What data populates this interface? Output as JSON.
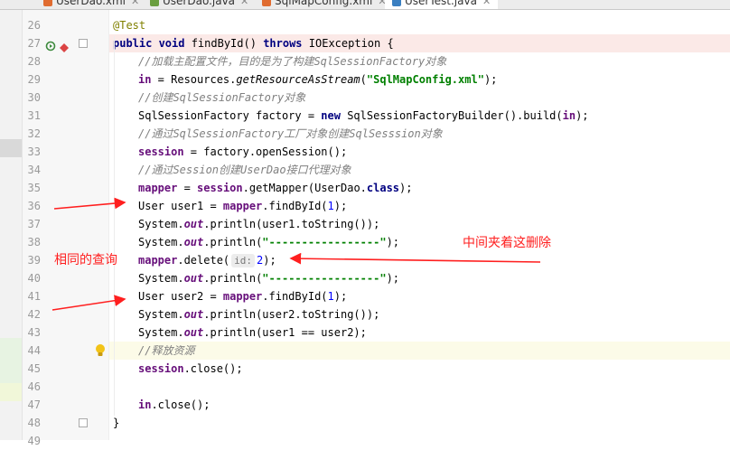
{
  "tabs": [
    {
      "label": "UserDao.xml",
      "icon_color": "#e06c30",
      "active": false
    },
    {
      "label": "UserDao.java",
      "icon_color": "#6a9e3f",
      "active": false
    },
    {
      "label": "SqlMapConfig.xml",
      "icon_color": "#e06c30",
      "active": false
    },
    {
      "label": "UserTest.java",
      "icon_color": "#3a7fc1",
      "active": true
    }
  ],
  "lines": [
    {
      "n": "26",
      "indent": 1,
      "tokens": [
        {
          "c": "ann",
          "t": "@Test"
        }
      ]
    },
    {
      "n": "27",
      "indent": 1,
      "hl": "method",
      "run_icon": true,
      "breakpoint": true,
      "tokens": [
        {
          "c": "kw",
          "t": "public void "
        },
        {
          "c": "",
          "t": "findById() "
        },
        {
          "c": "kw",
          "t": "throws "
        },
        {
          "c": "",
          "t": "IOException {"
        }
      ]
    },
    {
      "n": "28",
      "indent": 2,
      "tokens": [
        {
          "c": "cm",
          "t": "//加载主配置文件，目的是为了构建SqlSessionFactory对象"
        }
      ]
    },
    {
      "n": "29",
      "indent": 2,
      "tokens": [
        {
          "c": "fld",
          "t": "in"
        },
        {
          "c": "",
          "t": " = Resources."
        },
        {
          "c": "smeth",
          "t": "getResourceAsStream"
        },
        {
          "c": "",
          "t": "("
        },
        {
          "c": "str",
          "t": "\"SqlMapConfig.xml\""
        },
        {
          "c": "",
          "t": ");"
        }
      ]
    },
    {
      "n": "30",
      "indent": 2,
      "tokens": [
        {
          "c": "cm",
          "t": "//创建SqlSessionFactory对象"
        }
      ]
    },
    {
      "n": "31",
      "indent": 2,
      "tokens": [
        {
          "c": "",
          "t": "SqlSessionFactory factory = "
        },
        {
          "c": "kw",
          "t": "new "
        },
        {
          "c": "",
          "t": "SqlSessionFactoryBuilder().build("
        },
        {
          "c": "fld",
          "t": "in"
        },
        {
          "c": "",
          "t": ");"
        }
      ]
    },
    {
      "n": "32",
      "indent": 2,
      "tokens": [
        {
          "c": "cm",
          "t": "//通过SqlSessionFactory工厂对象创建SqlSesssion对象"
        }
      ]
    },
    {
      "n": "33",
      "indent": 2,
      "tokens": [
        {
          "c": "fld",
          "t": "session"
        },
        {
          "c": "",
          "t": " = factory.openSession();"
        }
      ]
    },
    {
      "n": "34",
      "indent": 2,
      "tokens": [
        {
          "c": "cm",
          "t": "//通过Session创建UserDao接口代理对象"
        }
      ]
    },
    {
      "n": "35",
      "indent": 2,
      "tokens": [
        {
          "c": "fld",
          "t": "mapper"
        },
        {
          "c": "",
          "t": " = "
        },
        {
          "c": "fld",
          "t": "session"
        },
        {
          "c": "",
          "t": ".getMapper(UserDao."
        },
        {
          "c": "kw",
          "t": "class"
        },
        {
          "c": "",
          "t": ");"
        }
      ]
    },
    {
      "n": "36",
      "indent": 2,
      "tokens": [
        {
          "c": "",
          "t": "User user1 = "
        },
        {
          "c": "fld",
          "t": "mapper"
        },
        {
          "c": "",
          "t": ".findById("
        },
        {
          "c": "num",
          "t": "1"
        },
        {
          "c": "",
          "t": ");"
        }
      ]
    },
    {
      "n": "37",
      "indent": 2,
      "tokens": [
        {
          "c": "",
          "t": "System."
        },
        {
          "c": "st",
          "t": "out"
        },
        {
          "c": "",
          "t": ".println(user1.toString());"
        }
      ]
    },
    {
      "n": "38",
      "indent": 2,
      "tokens": [
        {
          "c": "",
          "t": "System."
        },
        {
          "c": "st",
          "t": "out"
        },
        {
          "c": "",
          "t": ".println("
        },
        {
          "c": "str",
          "t": "\"-----------------\""
        },
        {
          "c": "",
          "t": ");"
        }
      ]
    },
    {
      "n": "39",
      "indent": 2,
      "tokens": [
        {
          "c": "fld",
          "t": "mapper"
        },
        {
          "c": "",
          "t": ".delete("
        },
        {
          "c": "hint",
          "t": "id:"
        },
        {
          "c": "num",
          "t": "2"
        },
        {
          "c": "",
          "t": ");"
        }
      ]
    },
    {
      "n": "40",
      "indent": 2,
      "tokens": [
        {
          "c": "",
          "t": "System."
        },
        {
          "c": "st",
          "t": "out"
        },
        {
          "c": "",
          "t": ".println("
        },
        {
          "c": "str",
          "t": "\"-----------------\""
        },
        {
          "c": "",
          "t": ");"
        }
      ]
    },
    {
      "n": "41",
      "indent": 2,
      "tokens": [
        {
          "c": "",
          "t": "User user2 = "
        },
        {
          "c": "fld",
          "t": "mapper"
        },
        {
          "c": "",
          "t": ".findById("
        },
        {
          "c": "num",
          "t": "1"
        },
        {
          "c": "",
          "t": ");"
        }
      ]
    },
    {
      "n": "42",
      "indent": 2,
      "tokens": [
        {
          "c": "",
          "t": "System."
        },
        {
          "c": "st",
          "t": "out"
        },
        {
          "c": "",
          "t": ".println(user2.toString());"
        }
      ]
    },
    {
      "n": "43",
      "indent": 2,
      "tokens": [
        {
          "c": "",
          "t": "System."
        },
        {
          "c": "st",
          "t": "out"
        },
        {
          "c": "",
          "t": ".println(user1 == user2);"
        }
      ]
    },
    {
      "n": "44",
      "indent": 2,
      "hl": "caret",
      "bulb": true,
      "tokens": [
        {
          "c": "cm",
          "t": "//释放资源"
        }
      ]
    },
    {
      "n": "45",
      "indent": 2,
      "tokens": [
        {
          "c": "fld",
          "t": "session"
        },
        {
          "c": "",
          "t": ".close();"
        }
      ]
    },
    {
      "n": "46",
      "indent": 2,
      "tokens": []
    },
    {
      "n": "47",
      "indent": 2,
      "tokens": [
        {
          "c": "fld",
          "t": "in"
        },
        {
          "c": "",
          "t": ".close();"
        }
      ]
    },
    {
      "n": "48",
      "indent": 1,
      "tokens": [
        {
          "c": "",
          "t": "}"
        }
      ]
    },
    {
      "n": "49",
      "indent": 1,
      "tokens": []
    }
  ],
  "annotations": {
    "same_query": "相同的查询",
    "delete_between": "中间夹着这删除"
  },
  "colors": {
    "annotation_red": "#ff1f1f",
    "method_highlight": "#fbe9e7",
    "caret_highlight": "#fcfbe8"
  }
}
